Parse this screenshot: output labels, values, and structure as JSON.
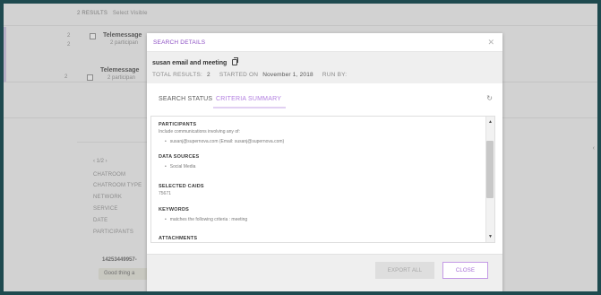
{
  "results_bar": {
    "count_label": "2 RESULTS",
    "select_visible": "Select Visible"
  },
  "rows": [
    {
      "index_a": "2",
      "index_b": "2",
      "title": "Telemessage",
      "subtitle": "2 participan"
    },
    {
      "index_a": "2",
      "title": "Telemessage",
      "subtitle": "2 participan"
    }
  ],
  "detail": {
    "pager": "‹ 1/2 ›",
    "labels": [
      "CHATROOM",
      "CHATROOM TYPE",
      "NETWORK",
      "SERVICE",
      "DATE",
      "PARTICIPANTS"
    ],
    "message_from": "14253449957-",
    "message_preview": "Good thing a"
  },
  "modal": {
    "title": "SEARCH DETAILS",
    "close_glyph": "✕",
    "search_name": "susan email and meeting",
    "total_results_label": "TOTAL RESULTS:",
    "total_results_value": "2",
    "started_on_label": "STARTED ON",
    "started_on_value": "November 1, 2018",
    "run_by_label": "RUN BY:",
    "run_by_value": "",
    "tabs": {
      "status": "SEARCH STATUS",
      "criteria": "CRITERIA SUMMARY"
    },
    "refresh_glyph": "↻",
    "criteria": {
      "participants_h": "PARTICIPANTS",
      "participants_t": "Include communications involving any of:",
      "participants_li": "susanj@supernova.com (Email: susanj@supernova.com)",
      "sources_h": "DATA SOURCES",
      "sources_li": "Social Media",
      "caids_h": "SELECTED CAIDS",
      "caids_t": "75671",
      "keywords_h": "KEYWORDS",
      "keywords_li": "matches the following criteria : meeting",
      "attachments_h": "ATTACHMENTS"
    },
    "buttons": {
      "export_all": "EXPORT ALL",
      "close": "CLOSE"
    }
  },
  "colors": {
    "accent": "#a56bd6",
    "page_bg": "#1f4a4f"
  }
}
